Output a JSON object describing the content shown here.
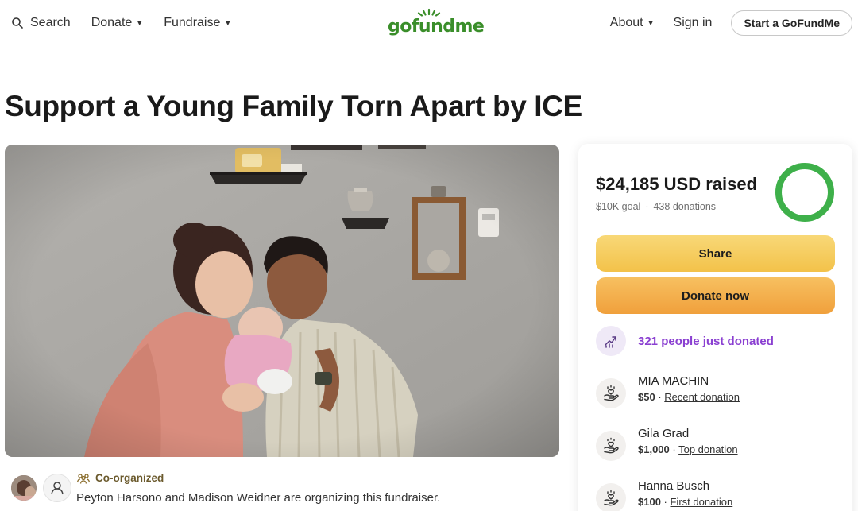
{
  "header": {
    "search_label": "Search",
    "donate_label": "Donate",
    "fundraise_label": "Fundraise",
    "logo_text": "gofundme",
    "about_label": "About",
    "signin_label": "Sign in",
    "start_label": "Start a GoFundMe"
  },
  "campaign": {
    "title": "Support a Young Family Torn Apart by ICE",
    "co_organized_label": "Co-organized",
    "organizers_text": "Peyton Harsono and Madison Weidner are organizing this fundraiser."
  },
  "donation": {
    "raised": "$24,185 USD raised",
    "goal": "$10K goal",
    "count": "438 donations",
    "progress_fraction": 1.0,
    "share_label": "Share",
    "donate_label": "Donate now",
    "trend_text": "321 people just donated",
    "donors": [
      {
        "name": "MIA MACHIN",
        "amount": "$50",
        "label": "Recent donation"
      },
      {
        "name": "Gila Grad",
        "amount": "$1,000",
        "label": "Top donation"
      },
      {
        "name": "Hanna Busch",
        "amount": "$100",
        "label": "First donation"
      }
    ]
  },
  "colors": {
    "brand_green": "#3a8e2a",
    "share_yellow": "#f3c24a",
    "donate_orange": "#f0a03c",
    "trend_purple": "#8a3fd1"
  }
}
